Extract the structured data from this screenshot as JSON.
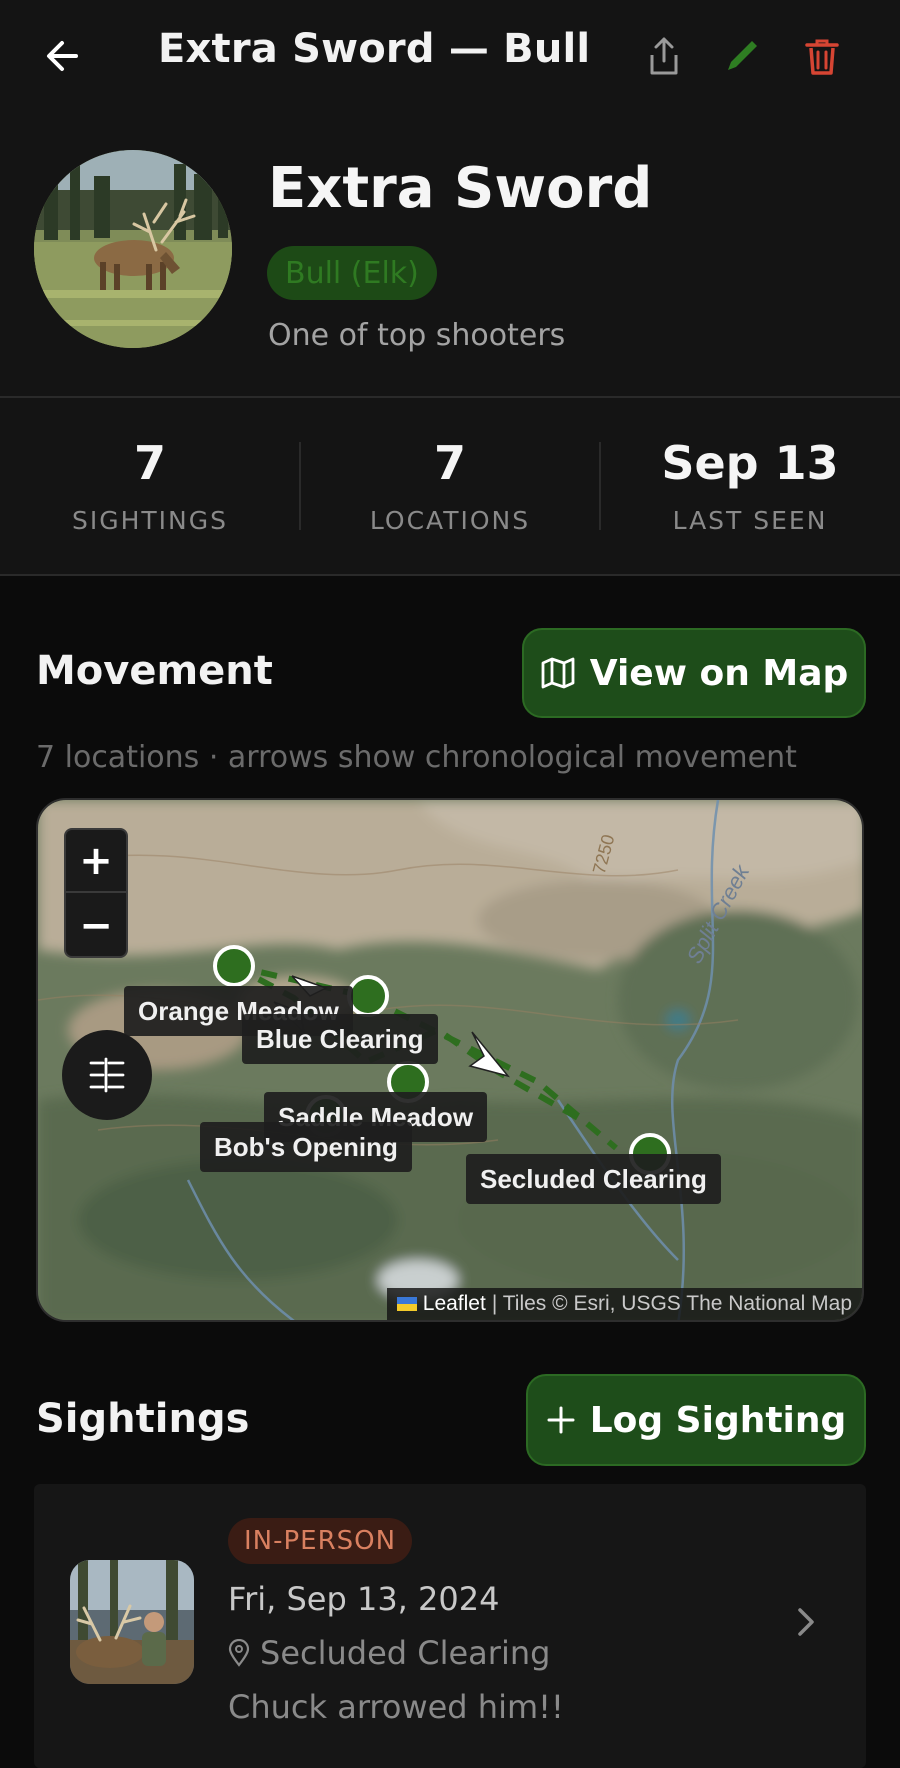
{
  "header": {
    "title": "Extra Sword — Bull",
    "back_icon": "back-arrow-icon",
    "actions": [
      {
        "name": "share",
        "icon": "share-icon"
      },
      {
        "name": "edit",
        "icon": "pencil-icon",
        "color": "#2e7d22"
      },
      {
        "name": "delete",
        "icon": "trash-icon",
        "color": "#d64533"
      }
    ]
  },
  "profile": {
    "name": "Extra Sword",
    "species": "Bull (Elk)",
    "description": "One of top shooters"
  },
  "stats": [
    {
      "value": "7",
      "label": "SIGHTINGS"
    },
    {
      "value": "7",
      "label": "LOCATIONS"
    },
    {
      "value": "Sep 13",
      "label": "LAST SEEN"
    }
  ],
  "movement": {
    "title": "Movement",
    "view_map_label": "View on Map",
    "subtitle": "7 locations · arrows show chronological movement",
    "map": {
      "zoom_in": "+",
      "zoom_out": "−",
      "labels": [
        "Orange Meadow",
        "Blue Clearing",
        "Saddle Meadow",
        "Bob's Opening",
        "Secluded Clearing"
      ],
      "terrain_text": [
        "7250",
        "Split Creek"
      ],
      "attribution_leaflet": "Leaflet",
      "attribution_rest": "| Tiles © Esri, USGS The National Map"
    }
  },
  "sightings": {
    "title": "Sightings",
    "log_label": "Log Sighting",
    "items": [
      {
        "mode": "IN-PERSON",
        "date": "Fri, Sep 13, 2024",
        "location": "Secluded Clearing",
        "note": "Chuck arrowed him!!"
      }
    ]
  },
  "colors": {
    "accent_green": "#1e4d1a",
    "marker_green": "#2e6e1f",
    "delete_red": "#d64533"
  }
}
